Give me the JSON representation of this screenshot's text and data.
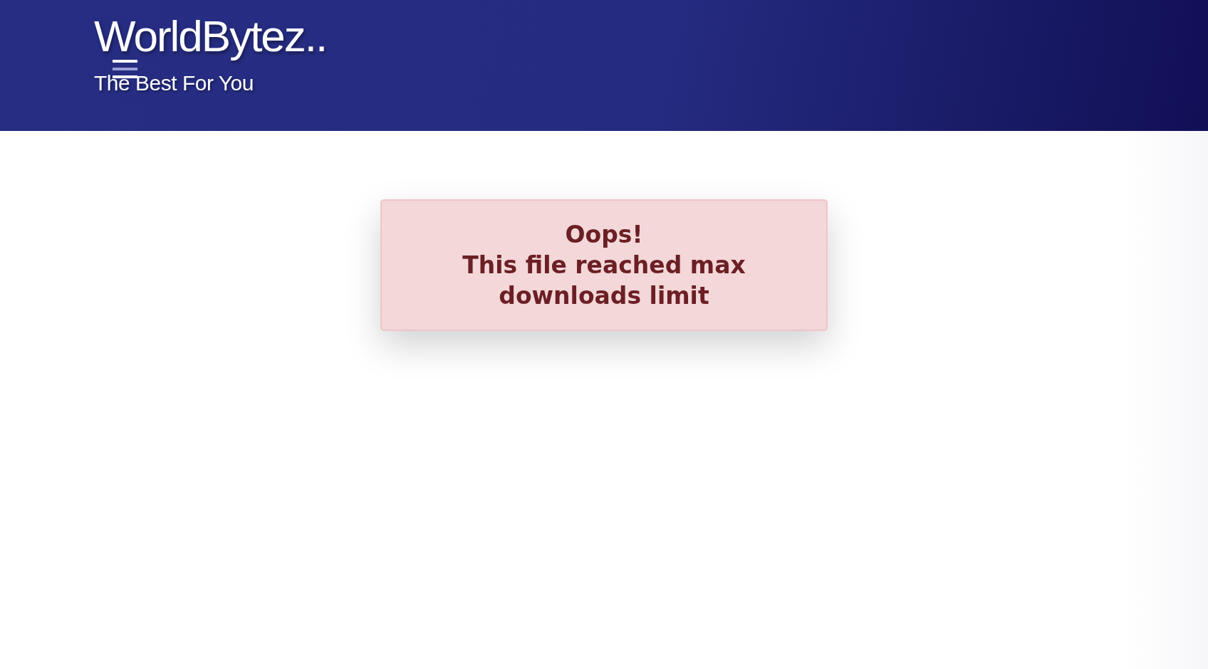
{
  "header": {
    "logo": "WorldBytez..",
    "tagline": "The Best For You"
  },
  "alert": {
    "title": "Oops!",
    "message": "This file reached max downloads limit"
  }
}
